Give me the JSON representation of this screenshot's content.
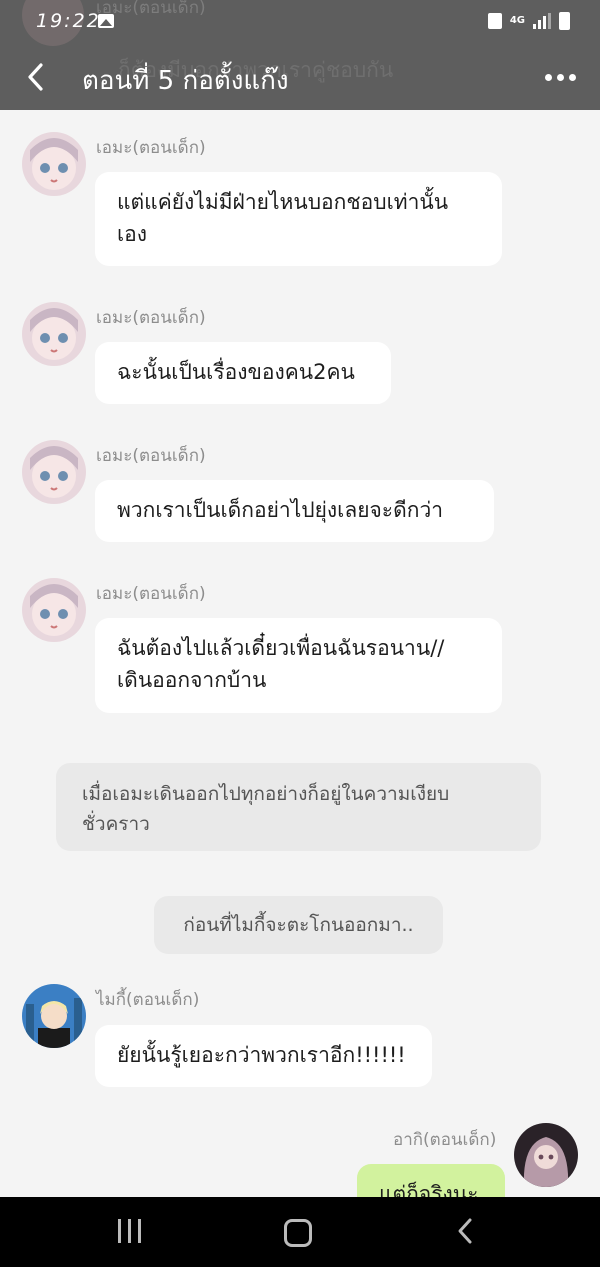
{
  "status_bar": {
    "time": "19:22",
    "network": "4G"
  },
  "header": {
    "title": "ตอนที่ 5 ก่อตั้งแก๊ง",
    "ghost_name": "เอมะ(ตอนเด็ก)",
    "ghost_text": "ก็ต้องมีบอกว่าพวกเราคู่ชอบกัน"
  },
  "messages": [
    {
      "sender": "เอมะ(ตอนเด็ก)",
      "text_lines": [
        "แต่แค่ยังไม่มีฝ่ายไหนบอกชอบเท่านั้น",
        "เอง"
      ]
    },
    {
      "sender": "เอมะ(ตอนเด็ก)",
      "text_lines": [
        "ฉะนั้นเป็นเรื่องของคน2คน"
      ]
    },
    {
      "sender": "เอมะ(ตอนเด็ก)",
      "text_lines": [
        "พวกเราเป็นเด็กอย่าไปยุ่งเลยจะดีกว่า"
      ]
    },
    {
      "sender": "เอมะ(ตอนเด็ก)",
      "text_lines": [
        "ฉันต้องไปแล้วเดี๋ยวเพื่อนฉันรอนาน//",
        "เดินออกจากบ้าน"
      ]
    }
  ],
  "narrations": [
    {
      "text_lines": [
        "เมื่อเอมะเดินออกไปทุกอย่างก็อยู่ในความเงียบ",
        "ชั่วคราว"
      ]
    },
    {
      "text_lines": [
        "ก่อนที่ไมกี้จะตะโกนออกมา.."
      ]
    }
  ],
  "mikey_message": {
    "sender": "ไมกี้(ตอนเด็ก)",
    "text": "ยัยนั้นรู้เยอะกว่าพวกเราอีก!!!!!!"
  },
  "self_message": {
    "sender": "อากิ(ตอนเด็ก)",
    "text": "แต่ก็จริงนะ"
  }
}
